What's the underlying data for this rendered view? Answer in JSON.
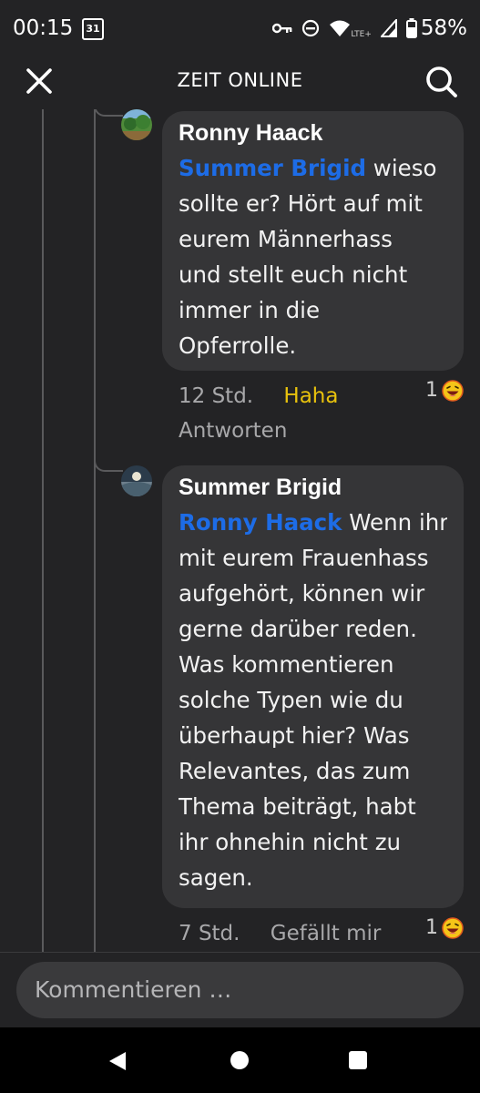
{
  "status_bar": {
    "time": "00:15",
    "calendar_day": "31",
    "network": "LTE+",
    "battery": "58%"
  },
  "app_bar": {
    "title": "ZEIT ONLINE"
  },
  "comments": [
    {
      "author": "Ronny Haack",
      "mention": "Summer Brigid",
      "lines": [
        " wieso",
        "sollte er? Hört auf mit",
        "eurem Männerhass",
        "und stellt euch nicht",
        "immer in die",
        "Opferrolle."
      ],
      "time": "12 Std.",
      "reaction_label": "Haha",
      "reply_label": "Antworten",
      "reaction_count": "1",
      "reaction_emoji": "laughing-emoji-icon"
    },
    {
      "author": "Summer Brigid",
      "mention": "Ronny Haack",
      "lines": [
        " Wenn ihr",
        "mit eurem Frauenhass",
        "aufgehört, können wir",
        "gerne darüber reden.",
        "Was kommentieren",
        "solche Typen wie du",
        "überhaupt hier? Was",
        "Relevantes, das zum",
        "Thema beiträgt, habt",
        "ihr ohnehin nicht zu",
        "sagen."
      ],
      "time": "7 Std.",
      "reaction_label": "Gefällt mir",
      "reaction_count": "1",
      "reaction_emoji": "laughing-emoji-icon"
    }
  ],
  "composer": {
    "placeholder": "Kommentieren …"
  },
  "colors": {
    "background": "#232325",
    "bubble": "#353537",
    "mention": "#1d6ce6",
    "reaction_active": "#e8c20d"
  }
}
